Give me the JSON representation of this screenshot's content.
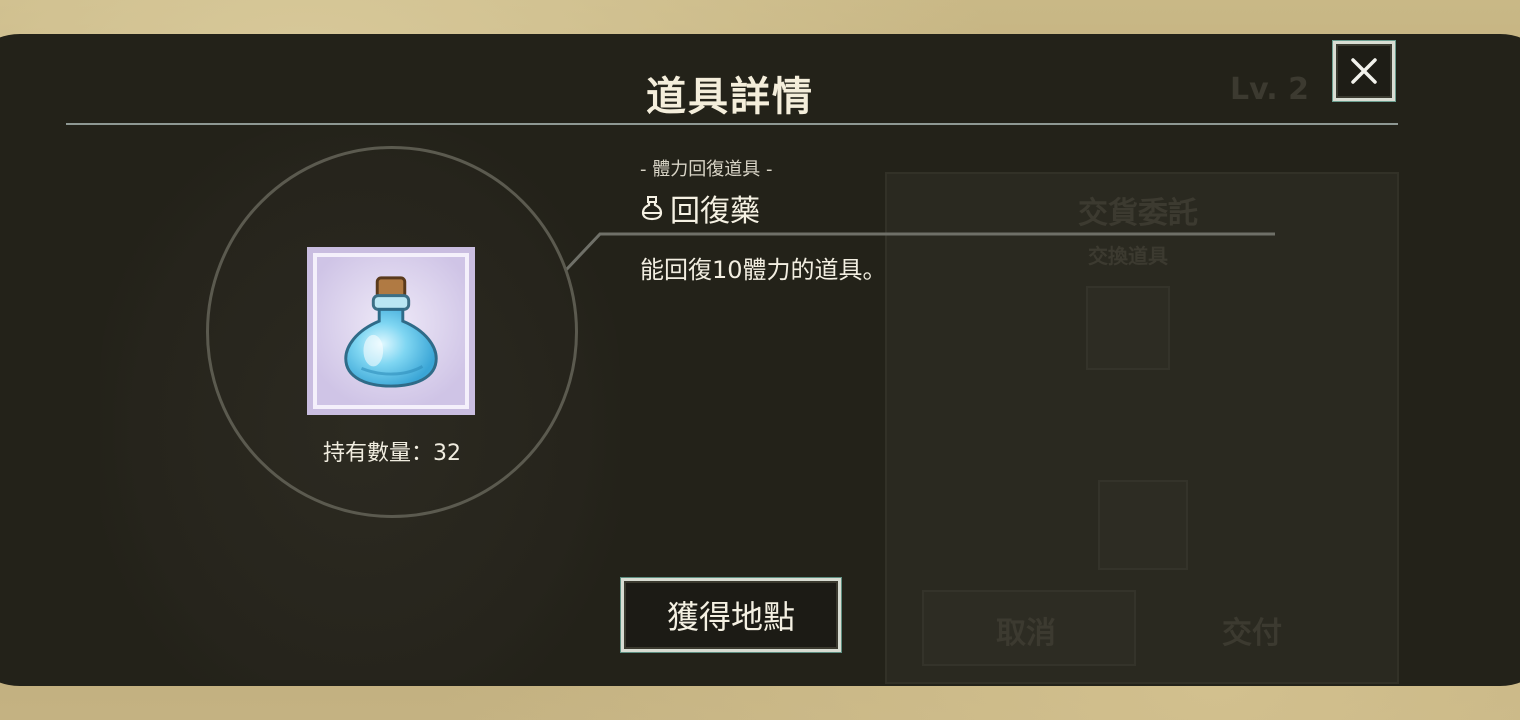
{
  "dialog": {
    "title": "道具詳情",
    "close_icon": "close-icon"
  },
  "item": {
    "category": "- 體力回復道具 -",
    "category_icon": "potion-small-icon",
    "name": "回復藥",
    "description": "能回復10體力的道具。",
    "image_icon": "potion-bottle-icon",
    "owned_label": "持有數量：32"
  },
  "actions": {
    "get_location_label": "獲得地點"
  },
  "background": {
    "level_badge": "Lv. 2",
    "panel_title": "交貨委託",
    "panel_subtitle": "交換道具",
    "cancel_label": "取消",
    "confirm_label": "交付"
  },
  "colors": {
    "overlay": "#232219",
    "text": "#f4eedb",
    "accent_border": "#d9ddd3",
    "item_frame": "#c9bde0"
  }
}
